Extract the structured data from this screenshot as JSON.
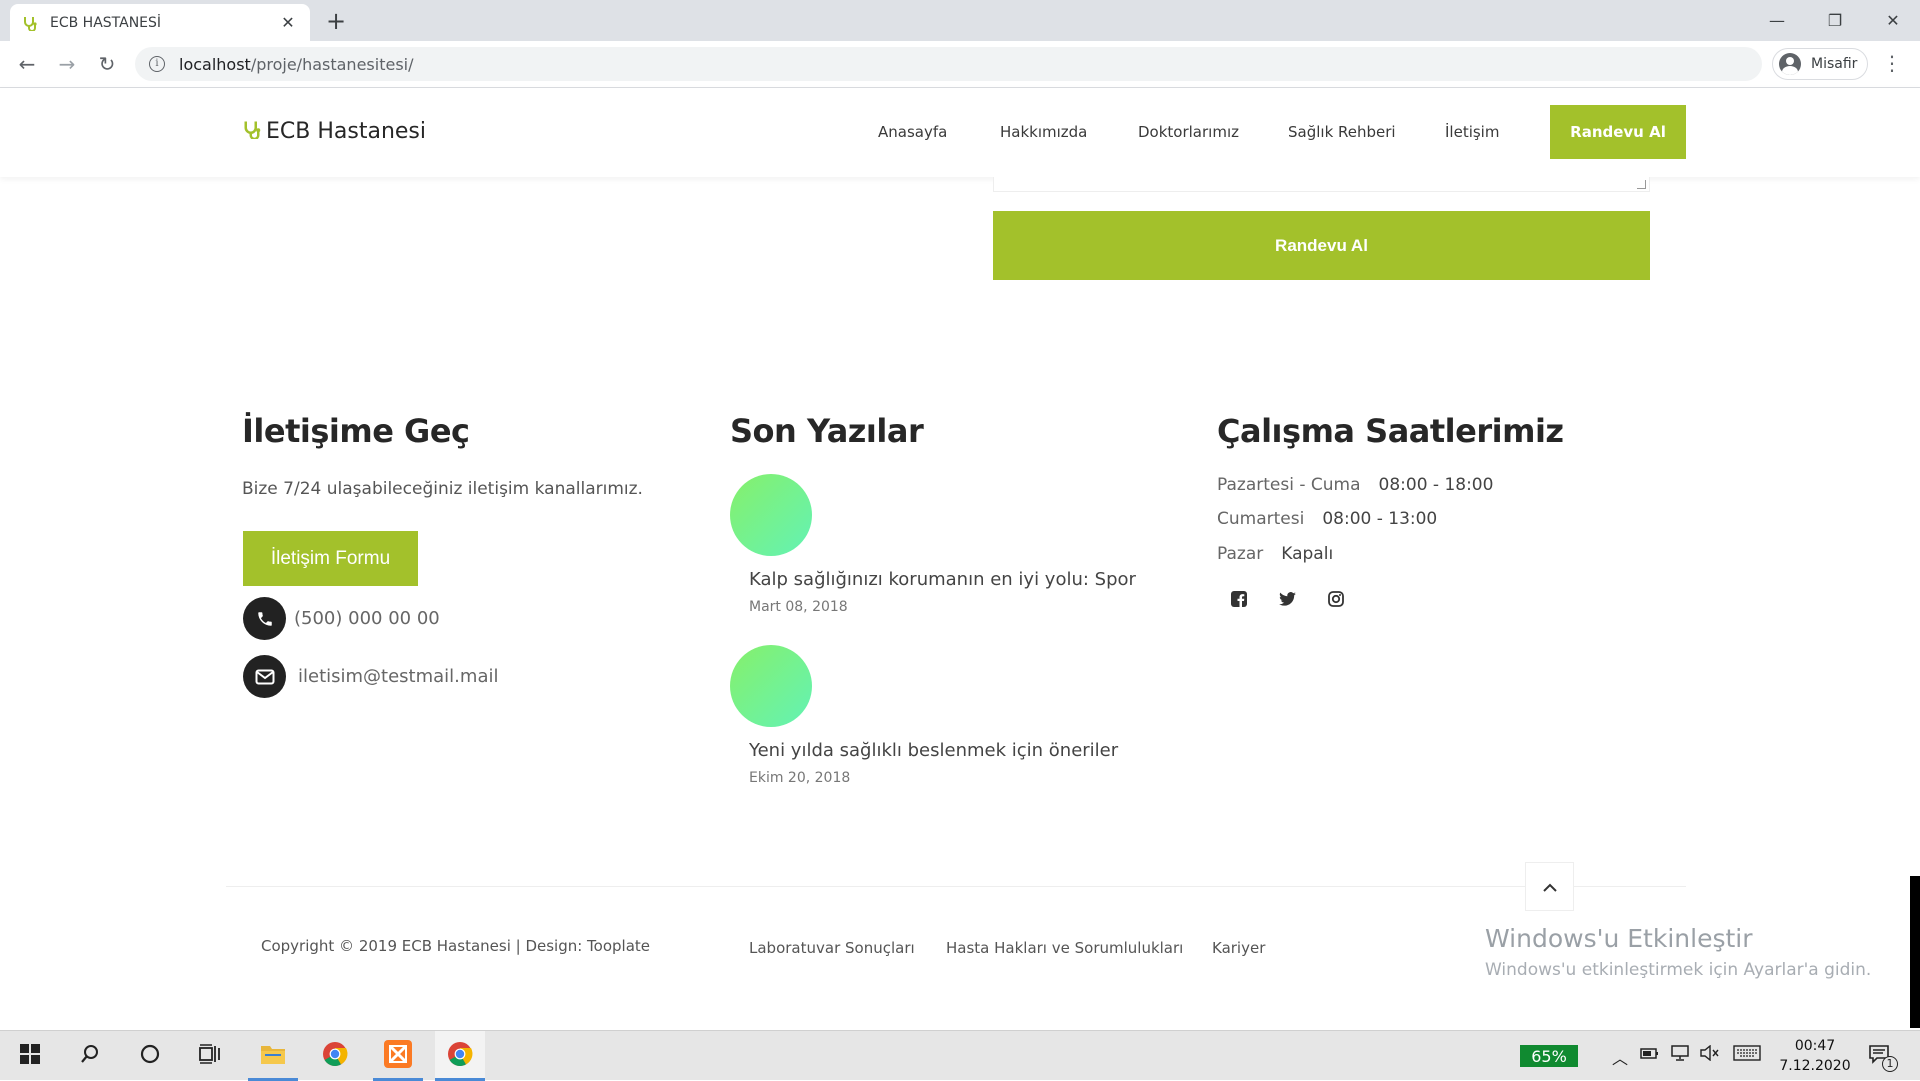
{
  "browser": {
    "tab_title": "ECB HASTANESİ",
    "url_host": "localhost",
    "url_path": "/proje/hastanesitesi/",
    "profile_name": "Misafir"
  },
  "site": {
    "brand": "ECB Hastanesi",
    "nav": [
      "Anasayfa",
      "Hakkımızda",
      "Doktorlarımız",
      "Sağlık Rehberi",
      "İletişim"
    ],
    "nav_cta": "Randevu Al",
    "submit_label": "Randevu Al"
  },
  "contact": {
    "title": "İletişime Geç",
    "lead": "Bize 7/24 ulaşabileceğiniz iletişim kanallarımız.",
    "form_button": "İletişim Formu",
    "phone": "(500) 000 00 00",
    "email": "iletisim@testmail.mail"
  },
  "posts": {
    "title": "Son Yazılar",
    "items": [
      {
        "title": "Kalp sağlığınızı korumanın en iyi yolu: Spor",
        "date": "Mart 08, 2018"
      },
      {
        "title": "Yeni yılda sağlıklı beslenmek için öneriler",
        "date": "Ekim 20, 2018"
      }
    ]
  },
  "hours": {
    "title": "Çalışma Saatlerimiz",
    "rows": [
      {
        "day": "Pazartesi - Cuma",
        "time": "08:00 - 18:00"
      },
      {
        "day": "Cumartesi",
        "time": "08:00 - 13:00"
      },
      {
        "day": "Pazar",
        "time": "Kapalı"
      }
    ],
    "social_icons": [
      "facebook-icon",
      "twitter-icon",
      "instagram-icon"
    ]
  },
  "footer": {
    "copyright": "Copyright © 2019 ECB Hastanesi | Design: Tooplate",
    "links": [
      "Laboratuvar Sonuçları",
      "Hasta Hakları ve Sorumlulukları",
      "Kariyer"
    ]
  },
  "windows": {
    "activate_title": "Windows'u Etkinleştir",
    "activate_sub": "Windows'u etkinleştirmek için Ayarlar'a gidin.",
    "battery": "65%",
    "time": "00:47",
    "date": "7.12.2020",
    "notif_count": "1"
  },
  "colors": {
    "accent": "#a3c12b",
    "dark": "#222222"
  }
}
